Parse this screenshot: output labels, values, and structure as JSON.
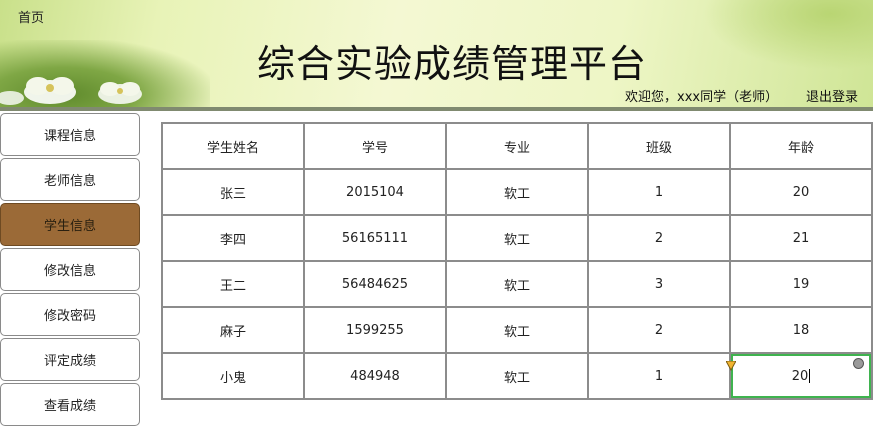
{
  "header": {
    "home": "首页",
    "title": "综合实验成绩管理平台",
    "welcome": "欢迎您，xxx同学（老师）",
    "logout": "退出登录"
  },
  "sidebar": {
    "items": [
      {
        "label": "课程信息",
        "active": false
      },
      {
        "label": "老师信息",
        "active": false
      },
      {
        "label": "学生信息",
        "active": true
      },
      {
        "label": "修改信息",
        "active": false
      },
      {
        "label": "修改密码",
        "active": false
      },
      {
        "label": "评定成绩",
        "active": false
      },
      {
        "label": "查看成绩",
        "active": false
      }
    ],
    "active_color": "#9b6a37"
  },
  "table": {
    "headers": [
      "学生姓名",
      "学号",
      "专业",
      "班级",
      "年龄"
    ],
    "rows": [
      [
        "张三",
        "2015104",
        "软工",
        "1",
        "20"
      ],
      [
        "李四",
        "56165111",
        "软工",
        "2",
        "21"
      ],
      [
        "王二",
        "56484625",
        "软工",
        "3",
        "19"
      ],
      [
        "麻子",
        "1599255",
        "软工",
        "2",
        "18"
      ],
      [
        "小鬼",
        "484948",
        "软工",
        "1",
        "20"
      ]
    ],
    "editing_cell_value": "20"
  }
}
